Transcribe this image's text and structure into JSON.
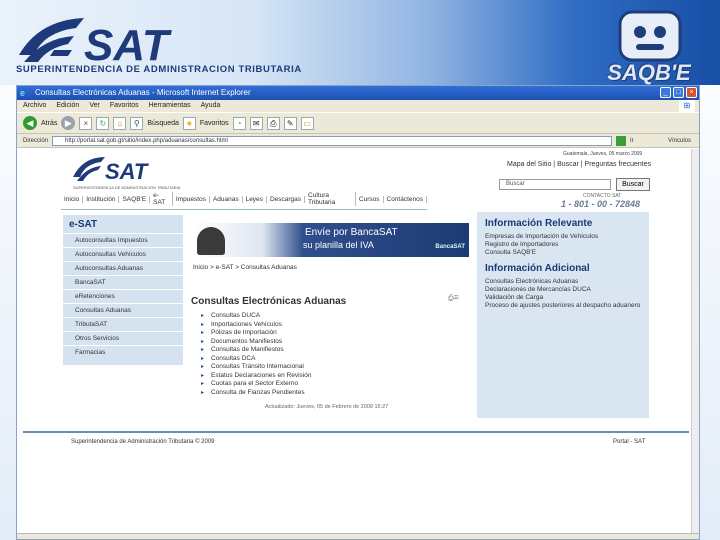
{
  "slide": {
    "org_title": "SUPERINTENDENCIA DE ADMINISTRACION TRIBUTARIA",
    "saqbe": "SAQB'E",
    "accent": "#1e4fb3"
  },
  "window": {
    "title": "Consultas Electrónicas Aduanas - Microsoft Internet Explorer",
    "menu": [
      "Archivo",
      "Edición",
      "Ver",
      "Favoritos",
      "Herramientas",
      "Ayuda"
    ],
    "toolbar": {
      "back": "Atrás",
      "search": "Búsqueda",
      "favorites": "Favoritos"
    },
    "address_label": "Dirección",
    "address_value": "http://portal.sat.gob.gt/sitio/index.php/aduanas/consultas.html",
    "go_label": "Ir",
    "links_label": "Vínculos"
  },
  "page": {
    "logo_text": "SAT",
    "logo_sub": "SUPERINTENDENCIA DE ADMINISTRACION TRIBUTARIA",
    "date": "Guatemala, Jueves, 05 marzo 2009",
    "top_links": "Mapa del Sitio | Buscar | Preguntas frecuentes",
    "search_placeholder": "Buscar",
    "search_button": "Buscar",
    "hotline_label": "CONTACTO SAT",
    "hotline": "1 - 801 - 00 - 72848",
    "nav": [
      "Inicio",
      "Institución",
      "SAQB'E",
      "e-SAT",
      "Impuestos",
      "Aduanas",
      "Leyes",
      "Descargas",
      "Cultura Tributaria",
      "Cursos",
      "Contáctenos"
    ],
    "left_menu": {
      "title": "e-SAT",
      "items": [
        "Autoconsultas Impuestos",
        "Autoconsultas Vehículos",
        "Autoconsultas Aduanas",
        "BancaSAT",
        "eRetenciones",
        "Consultas Aduanas",
        "TributaSAT",
        "Otros Servicios",
        "Farmacias"
      ]
    },
    "promo": {
      "line1": "Envíe por BancaSAT",
      "line2": "su planilla del IVA",
      "brand": "BancaSAT"
    },
    "breadcrumb": "Inicio > e-SAT > Consultas Aduanas",
    "main_title": "Consultas Electrónicas Aduanas",
    "main_items": [
      "Consultas DUCA",
      "Importaciones Vehículos",
      "Pólizas de Importación",
      "Documentos Manifiestos",
      "Consultas de Manifiestos",
      "Consultas DCA",
      "Consultas Tránsito Internacional",
      "Estatus Declaraciones en Revisión",
      "Cuotas para el Sector Externo",
      "Consulta de Fianzas Pendientes"
    ],
    "updated": "Actualizado: Jueves, 05 de Febrero de 2009 15:27",
    "right": {
      "title1": "Información Relevante",
      "text1": [
        "Empresas de Importación de Vehículos",
        "Registro de Importadores",
        "Consulta SAQB'E"
      ],
      "title2": "Información Adicional",
      "text2": [
        "Consultas Electrónicas Aduanas",
        "Declaraciones de Mercancías DUCA",
        "Validación de Carga",
        "Proceso de ajustes posteriores al despacho aduanero"
      ]
    },
    "footer_left": "Superintendencia de Administración Tributaria © 2009",
    "footer_right": "Portal - SAT"
  }
}
